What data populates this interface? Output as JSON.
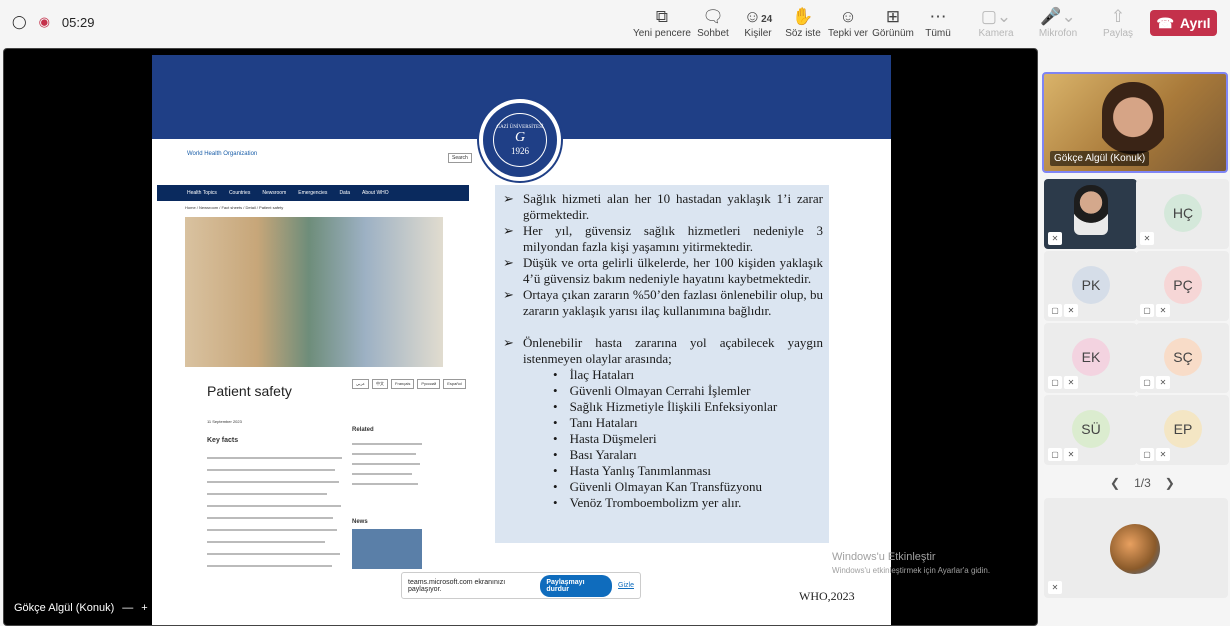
{
  "meeting": {
    "timer": "05:29"
  },
  "toolbar": {
    "new_window": "Yeni pencere",
    "chat": "Sohbet",
    "people_count": "24",
    "people": "Kişiler",
    "raise_hand": "Söz iste",
    "react": "Tepki ver",
    "view": "Görünüm",
    "more": "Tümü",
    "camera": "Kamera",
    "mic": "Mikrofon",
    "share": "Paylaş",
    "leave": "Ayrıl"
  },
  "slide": {
    "logo_text": "GAZİ ÜNİVERSİTESİ",
    "logo_year": "1926",
    "who_page": {
      "org": "World Health Organization",
      "search": "Search",
      "nav": [
        "Health Topics",
        "Countries",
        "Newsroom",
        "Emergencies",
        "Data",
        "About WHO"
      ],
      "breadcrumb": "Home / Newsroom / Fact sheets / Detail / Patient safety",
      "title": "Patient safety",
      "date": "11 September 2023",
      "languages": [
        "عربي",
        "中文",
        "Français",
        "Русский",
        "Español"
      ],
      "key_facts": "Key facts",
      "related": "Related",
      "news": "News"
    },
    "bullets": [
      "Sağlık hizmeti alan her 10 hastadan yaklaşık 1’i zarar görmektedir.",
      "Her yıl, güvensiz sağlık hizmetleri nedeniyle 3 milyondan fazla kişi yaşamını yitirmektedir.",
      "Düşük ve orta gelirli ülkelerde, her 100 kişiden yaklaşık 4’ü güvensiz bakım nedeniyle hayatını kaybetmektedir.",
      "Ortaya çıkan zararın %50’den fazlası önlenebilir olup, bu zararın yaklaşık yarısı ilaç kullanımına bağlıdır.",
      "Önlenebilir hasta zararına yol açabilecek yaygın istenmeyen olaylar arasında;"
    ],
    "events": [
      "İlaç Hataları",
      "Güvenli Olmayan Cerrahi İşlemler",
      "Sağlık Hizmetiyle İlişkili Enfeksiyonlar",
      "Tanı Hataları",
      "Hasta Düşmeleri",
      "Bası Yaraları",
      "Hasta Yanlış Tanımlanması",
      "Güvenli Olmayan Kan Transfüzyonu",
      "Venöz Tromboembolizm yer alır."
    ],
    "source": "WHO,2023"
  },
  "share_bar": {
    "text": "teams.microsoft.com ekranınızı paylaşıyor.",
    "stop": "Paylaşmayı durdur",
    "hide": "Gizle"
  },
  "watermark": {
    "line1": "Windows'u Etkinleştir",
    "line2": "Windows'u etkinleştirmek için Ayarlar'a gidin."
  },
  "presenter": "Gökçe Algül (Konuk)",
  "participants": {
    "main_name": "Gökçe Algül (Konuk)",
    "tiles": [
      {
        "initials": "",
        "color": "#ececec"
      },
      {
        "initials": "HÇ",
        "color": "#d4e8da"
      },
      {
        "initials": "PK",
        "color": "#d5dde8"
      },
      {
        "initials": "PÇ",
        "color": "#f6d6d6"
      },
      {
        "initials": "EK",
        "color": "#f3d3e0"
      },
      {
        "initials": "SÇ",
        "color": "#f8dcc8"
      },
      {
        "initials": "SÜ",
        "color": "#dbeccf"
      },
      {
        "initials": "EP",
        "color": "#f4e6c4"
      }
    ],
    "page": "1/3"
  }
}
